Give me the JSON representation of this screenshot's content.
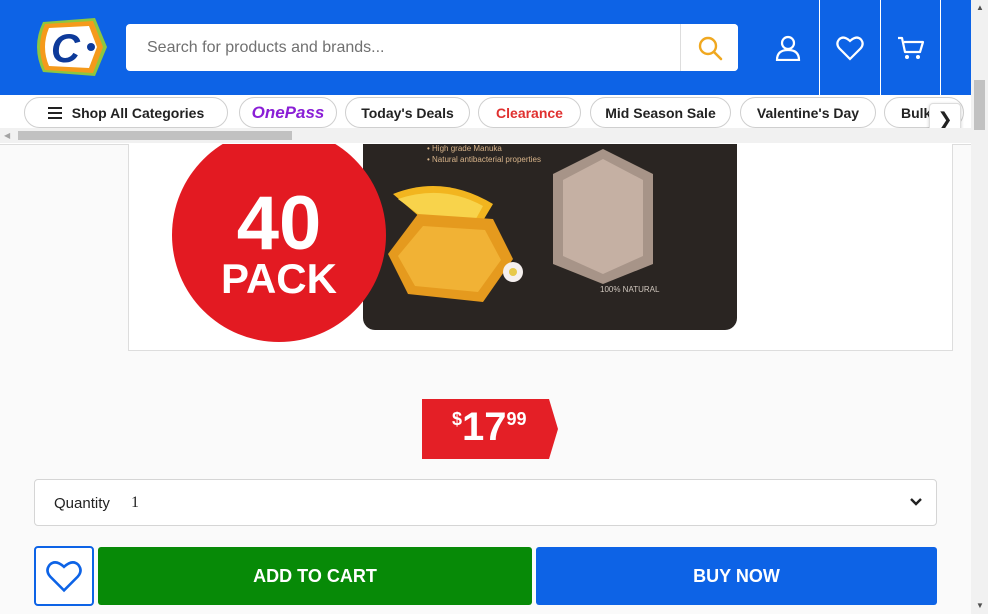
{
  "header": {
    "logo_letter": "C",
    "search": {
      "placeholder": "Search for products and brands..."
    },
    "icons": [
      "account-icon",
      "heart-icon",
      "cart-icon"
    ],
    "colors": {
      "brand_blue": "#0d63e6",
      "logo_orange": "#f59a1b",
      "logo_green": "#8dc63f"
    }
  },
  "nav": {
    "items": [
      {
        "label": "Shop All Categories"
      },
      {
        "label": "OnePass"
      },
      {
        "label": "Today's Deals"
      },
      {
        "label": "Clearance"
      },
      {
        "label": "Mid Season Sale"
      },
      {
        "label": "Valentine's Day"
      },
      {
        "label": "Bulk"
      }
    ],
    "next_label": "❯"
  },
  "product": {
    "badge_number": "40",
    "badge_word": "PACK",
    "bag_lines": [
      "• High grade Manuka",
      "• Natural antibacterial properties"
    ],
    "bag_natural": "100% NATURAL"
  },
  "price": {
    "symbol": "$",
    "dollars": "17",
    "cents": "99",
    "color": "#e41f26"
  },
  "quantity": {
    "label": "Quantity",
    "value": "1",
    "chevron": "⌄"
  },
  "actions": {
    "add_to_cart": "ADD TO CART",
    "buy_now": "BUY NOW",
    "colors": {
      "add": "#078a07",
      "buy": "#0d63e6"
    }
  }
}
